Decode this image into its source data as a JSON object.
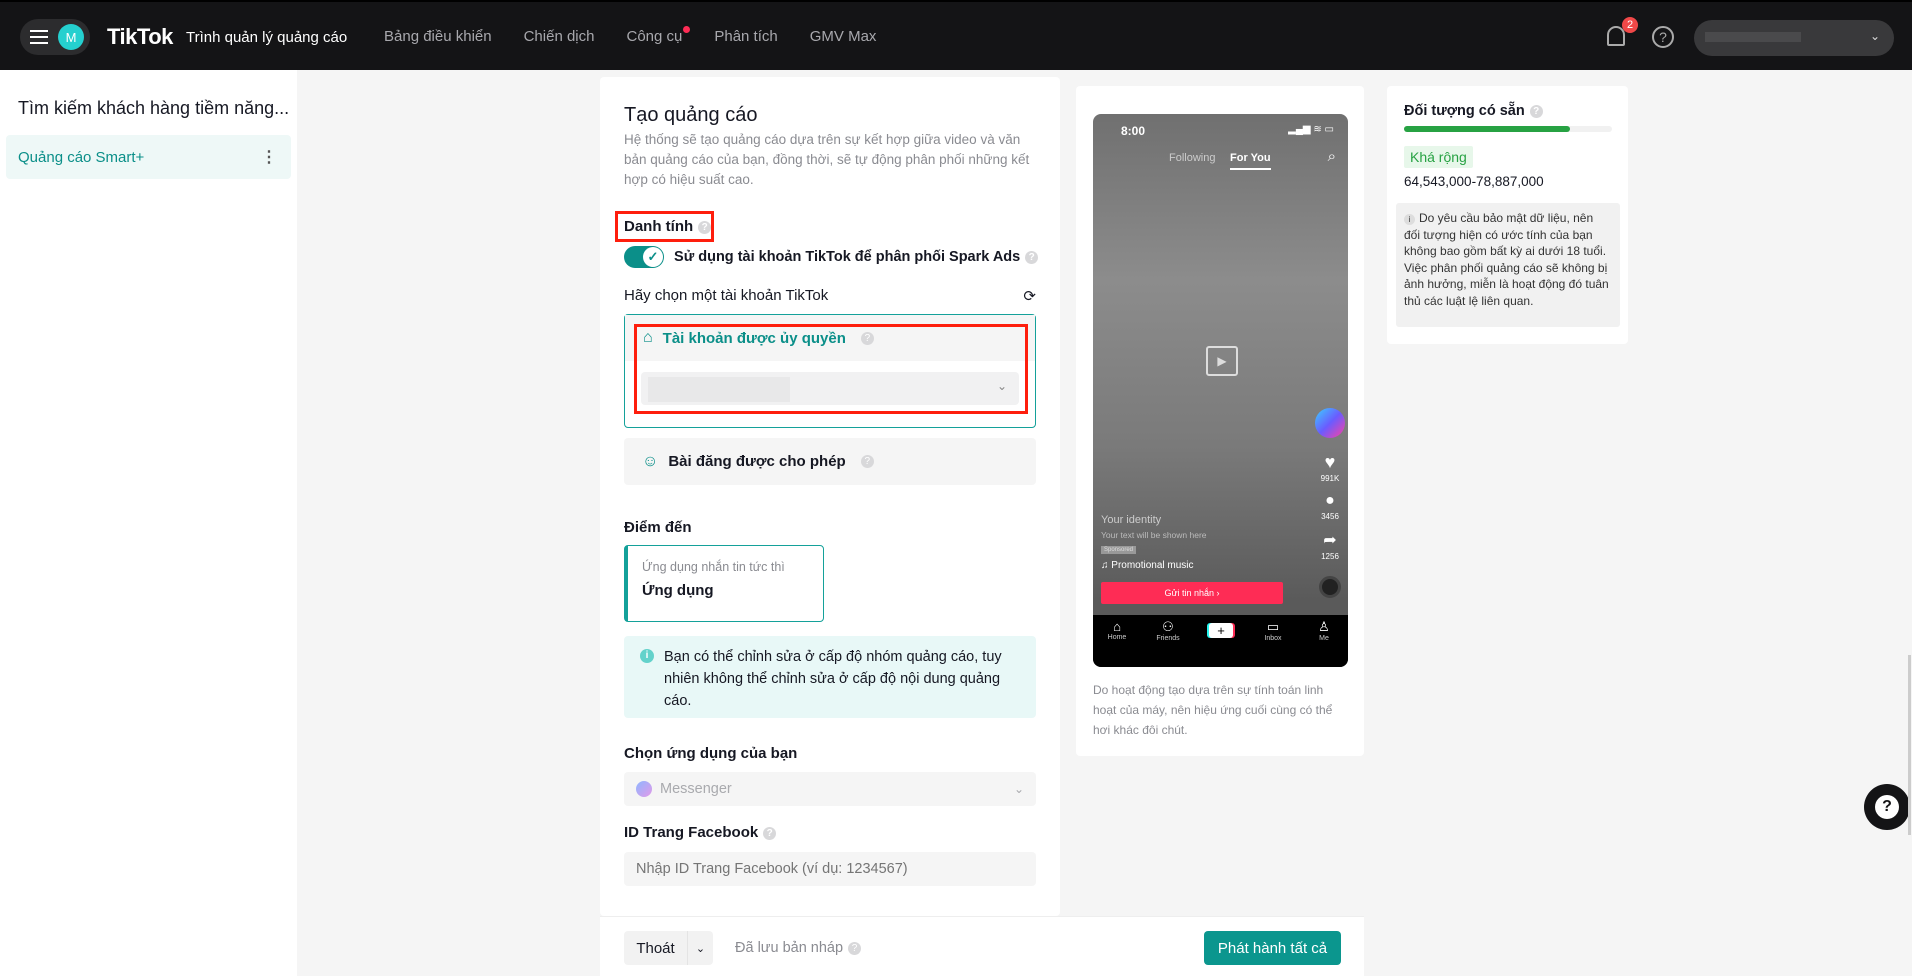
{
  "header": {
    "avatar_letter": "M",
    "logo": "TikTok",
    "logo_subtitle": "Trình quản lý quảng cáo",
    "nav": [
      "Bảng điều khiển",
      "Chiến dịch",
      "Công cụ",
      "Phân tích",
      "GMV Max"
    ],
    "notification_count": "2"
  },
  "sidebar": {
    "title": "Tìm kiếm khách hàng tiềm năng...",
    "items": [
      {
        "label": "Quảng cáo Smart+"
      }
    ]
  },
  "form": {
    "title": "Tạo quảng cáo",
    "description": "Hệ thống sẽ tạo quảng cáo dựa trên sự kết hợp giữa video và văn bản quảng cáo của bạn, đồng thời, sẽ tự động phân phối những kết hợp có hiệu suất cao.",
    "identity_label": "Danh tính",
    "spark_toggle_label": "Sử dụng tài khoản TikTok để phân phối Spark Ads",
    "spark_enabled": true,
    "choose_account_label": "Hãy chọn một tài khoản TikTok",
    "authorized_account_label": "Tài khoản được ủy quyền",
    "allowed_posts_label": "Bài đăng được cho phép",
    "destination_label": "Điểm đến",
    "destination_card": {
      "subtitle": "Ứng dụng nhắn tin tức thì",
      "title": "Ứng dụng"
    },
    "info_text": "Bạn có thể chỉnh sửa ở cấp độ nhóm quảng cáo, tuy nhiên không thể chỉnh sửa ở cấp độ nội dung quảng cáo.",
    "choose_app_label": "Chọn ứng dụng của bạn",
    "app_value": "Messenger",
    "fb_page_label": "ID Trang Facebook",
    "fb_page_placeholder": "Nhập ID Trang Facebook (ví dụ: 1234567)"
  },
  "footer": {
    "exit_label": "Thoát",
    "saved_label": "Đã lưu bản nháp",
    "publish_label": "Phát hành tất cả"
  },
  "preview": {
    "time": "8:00",
    "tab_following": "Following",
    "tab_for_you": "For You",
    "likes": "991K",
    "comments": "3456",
    "shares": "1256",
    "identity": "Your identity",
    "text": "Your text will be shown here",
    "sponsored": "Sponsored",
    "music": "♫ Promotional music",
    "cta": "Gửi tin nhắn ›",
    "nav": [
      "Home",
      "Friends",
      "Inbox",
      "Me"
    ],
    "note": "Do hoạt động tạo dựa trên sự tính toán linh hoạt của máy, nên hiệu ứng cuối cùng có thể hơi khác đôi chút."
  },
  "audience": {
    "title": "Đối tượng có sẵn",
    "level_fraction": 0.8,
    "tag": "Khá rộng",
    "range": "64,543,000-78,887,000",
    "note": "Do yêu cầu bảo mật dữ liệu, nên đối tượng hiện có ước tính của bạn không bao gồm bất kỳ ai dưới 18 tuổi. Việc phân phối quảng cáo sẽ không bị ảnh hưởng, miễn là hoạt động đó tuân thủ các luật lệ liên quan."
  }
}
